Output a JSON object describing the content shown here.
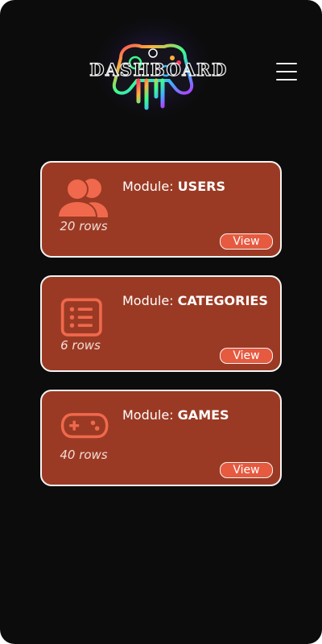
{
  "header": {
    "title": "DASHBOARD"
  },
  "colors": {
    "background": "#0c0c0c",
    "card": "#9b3a24",
    "card_border": "#f4f4f4",
    "icon": "#f0694d",
    "button": "#e65a40"
  },
  "modules": [
    {
      "label": "Module:",
      "name": "USERS",
      "count": "20 rows",
      "view_label": "View",
      "icon": "users-icon"
    },
    {
      "label": "Module:",
      "name": "CATEGORIES",
      "count": "6 rows",
      "view_label": "View",
      "icon": "list-icon"
    },
    {
      "label": "Module:",
      "name": "GAMES",
      "count": "40 rows",
      "view_label": "View",
      "icon": "gamepad-icon"
    }
  ]
}
